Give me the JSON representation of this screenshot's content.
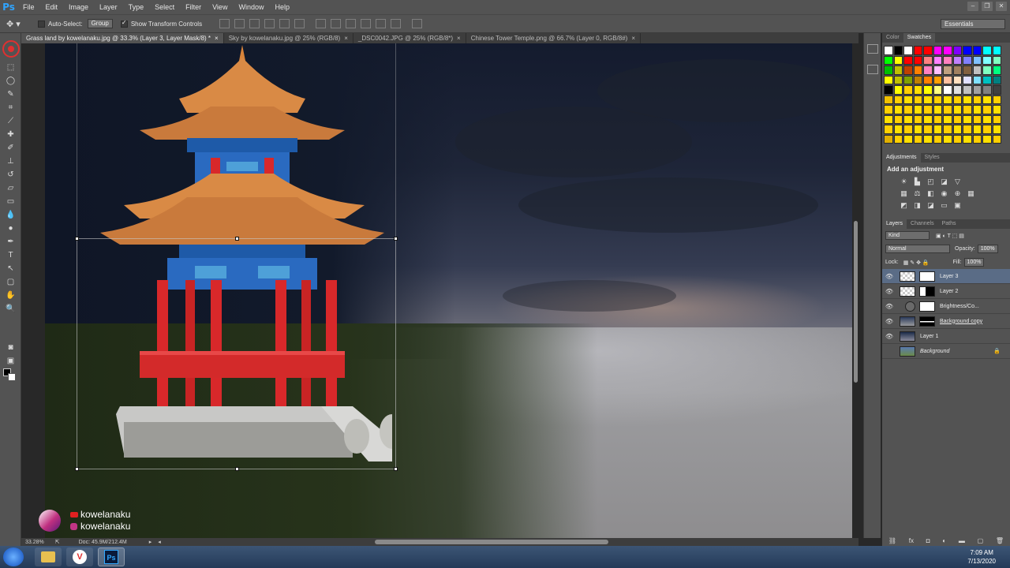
{
  "app": {
    "logo": "Ps"
  },
  "menu": [
    "File",
    "Edit",
    "Image",
    "Layer",
    "Type",
    "Select",
    "Filter",
    "View",
    "Window",
    "Help"
  ],
  "options": {
    "auto_select_label": "Auto-Select:",
    "auto_select_value": "Group",
    "show_transform_label": "Show Transform Controls",
    "workspace": "Essentials"
  },
  "tabs": [
    "Grass land by kowelanaku.jpg @ 33.3% (Layer 3, Layer Mask/8) *",
    "Sky by kowelanaku.jpg @ 25% (RGB/8)",
    "_DSC0042.JPG @ 25% (RGB/8*)",
    "Chinese Tower Temple.png @ 66.7% (Layer 0, RGB/8#)"
  ],
  "status": {
    "zoom": "33.28%",
    "doc": "Doc: 45.9M/212.4M"
  },
  "watermark": {
    "youtube": "kowelanaku",
    "instagram": "kowelanaku"
  },
  "panels": {
    "swatch_tabs": [
      "Color",
      "Swatches"
    ],
    "adjust_tabs": [
      "Adjustments",
      "Styles"
    ],
    "adjust_title": "Add an adjustment",
    "layer_tabs": [
      "Layers",
      "Channels",
      "Paths"
    ],
    "kind": "Kind",
    "blend_mode": "Normal",
    "opacity_label": "Opacity:",
    "opacity": "100%",
    "lock_label": "Lock:",
    "fill_label": "Fill:",
    "fill": "100%",
    "layers": [
      {
        "name": "Layer 3"
      },
      {
        "name": "Layer 2"
      },
      {
        "name": "Brightness/Co..."
      },
      {
        "name": "Background copy"
      },
      {
        "name": "Layer 1"
      },
      {
        "name": "Background"
      }
    ]
  },
  "taskbar": {
    "time": "7:09 AM",
    "date": "7/13/2020"
  },
  "colors": {
    "swatches": [
      "#ffffff",
      "#000000",
      "#ffffff",
      "#ff0000",
      "#ff0000",
      "#ff00ff",
      "#ff00ff",
      "#8000ff",
      "#0000ff",
      "#0000ff",
      "#00ffff",
      "#00ffff",
      "#00ff00",
      "#ffff00",
      "#ff0000",
      "#ff0000",
      "#ff8080",
      "#ff80ff",
      "#ff80c0",
      "#c080ff",
      "#8080ff",
      "#80c0ff",
      "#80ffff",
      "#80ffc0",
      "#00c000",
      "#c0c000",
      "#c04000",
      "#ff8000",
      "#ff80c0",
      "#ffc0ff",
      "#c0a080",
      "#a08060",
      "#806040",
      "#c0c0c0",
      "#80ffc0",
      "#00ff80",
      "#ffff00",
      "#c0c000",
      "#80a000",
      "#c08000",
      "#ff8000",
      "#ffa000",
      "#ffc0a0",
      "#ffe0c0",
      "#e0e0ff",
      "#80e0ff",
      "#00c0c0",
      "#008080",
      "#000000",
      "#ffff00",
      "#ffd000",
      "#ffe000",
      "#ffff00",
      "#ffff80",
      "#ffffff",
      "#e0e0e0",
      "#c0c0c0",
      "#a0a0a0",
      "#808080",
      "#404040",
      "#f0c000",
      "#ffd000",
      "#ffe000",
      "#ffd000",
      "#ffe000",
      "#ffd000",
      "#ffe000",
      "#ffd000",
      "#ffe000",
      "#ffd000",
      "#ffe000",
      "#ffd000",
      "#ffd000",
      "#ffe000",
      "#ffd000",
      "#ffe000",
      "#ffd000",
      "#ffe000",
      "#ffd000",
      "#ffe000",
      "#ffd000",
      "#ffe000",
      "#ffd000",
      "#ffe000",
      "#ffe000",
      "#ffd000",
      "#ffe000",
      "#ffd000",
      "#ffe000",
      "#ffd000",
      "#ffe000",
      "#ffd000",
      "#ffe000",
      "#ffd000",
      "#ffe000",
      "#ffd000",
      "#ffd000",
      "#ffe000",
      "#ffd000",
      "#ffe000",
      "#ffd000",
      "#ffe000",
      "#ffd000",
      "#ffe000",
      "#ffd000",
      "#ffe000",
      "#ffd000",
      "#ffe000",
      "#e0b000",
      "#ffd000",
      "#ffe000",
      "#ffd000",
      "#ffe000",
      "#ffd000",
      "#ffe000",
      "#ffd000",
      "#ffe000",
      "#ffd000",
      "#ffe000",
      "#ffd000"
    ]
  }
}
